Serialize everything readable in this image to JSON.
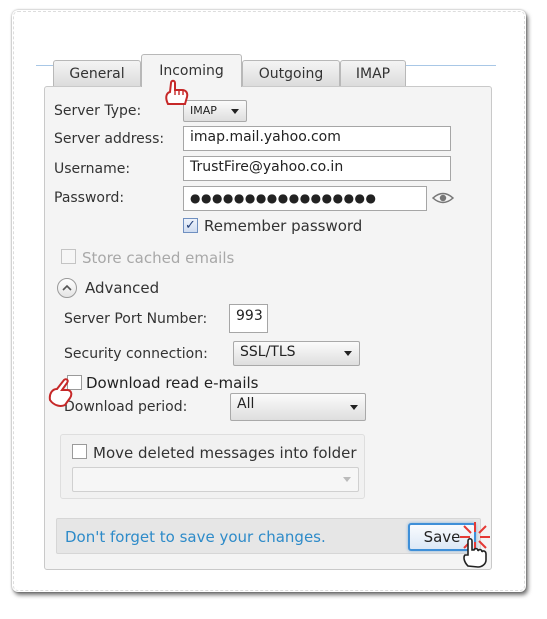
{
  "tabs": [
    {
      "label": "General"
    },
    {
      "label": "Incoming"
    },
    {
      "label": "Outgoing"
    },
    {
      "label": "IMAP"
    }
  ],
  "active_tab": "Incoming",
  "form": {
    "server_type": {
      "label": "Server Type:",
      "value": "IMAP"
    },
    "server_address": {
      "label": "Server address:",
      "value": "imap.mail.yahoo.com"
    },
    "username": {
      "label": "Username:",
      "value": "TrustFire@yahoo.co.in"
    },
    "password": {
      "label": "Password:",
      "value": "●●●●●●●●●●●●●●●●●"
    },
    "remember_password": {
      "label": "Remember password",
      "checked": true
    },
    "store_cached_emails": {
      "label": "Store cached emails",
      "checked": false,
      "disabled": true
    },
    "advanced": {
      "label": "Advanced"
    },
    "server_port": {
      "label": "Server Port Number:",
      "value": "993"
    },
    "security_connection": {
      "label": "Security connection:",
      "value": "SSL/TLS"
    },
    "download_read": {
      "label": "Download read e-mails",
      "checked": false
    },
    "download_period": {
      "label": "Download period:",
      "value": "All"
    },
    "move_deleted": {
      "label": "Move deleted messages into folder",
      "checked": false,
      "folder_value": ""
    }
  },
  "footer": {
    "hint": "Don't forget to save your changes.",
    "save_label": "Save"
  },
  "colors": {
    "accent": "#3e8fd8",
    "hint_text": "#2e8bc9",
    "pointer_hand": "#e23b3b"
  }
}
